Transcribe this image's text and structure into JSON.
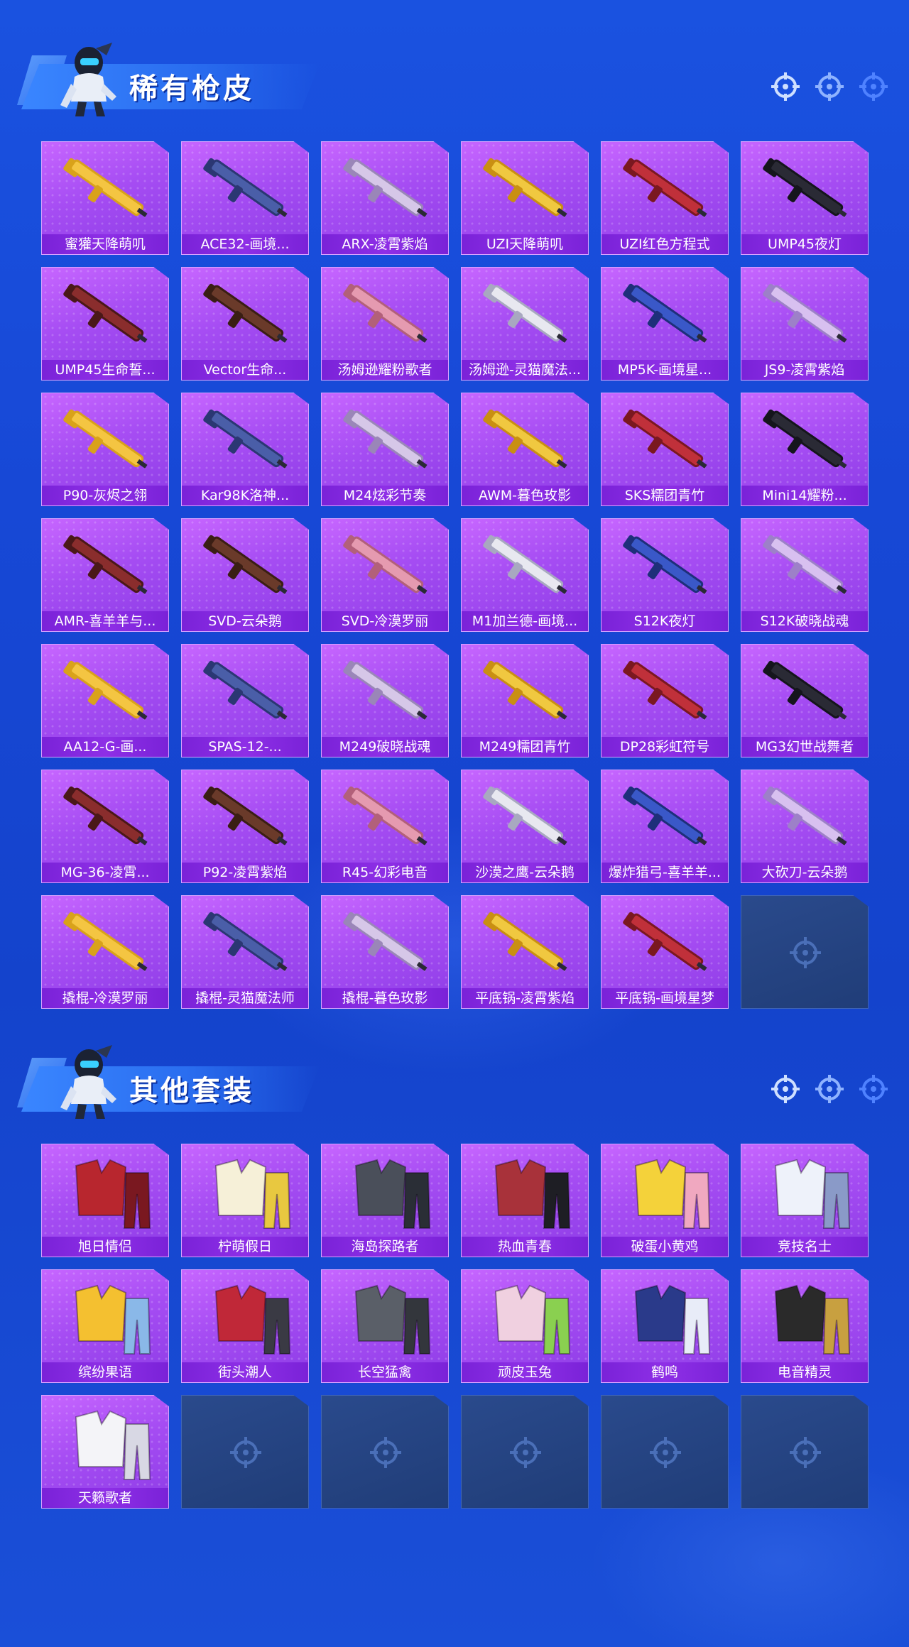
{
  "colors": {
    "background": "#1748d6",
    "card_purple": "#a64df3",
    "label_purple": "#8e2fe6",
    "empty_slot": "#203d78"
  },
  "sections": [
    {
      "title": "稀有枪皮",
      "items": [
        {
          "label": "蜜獾天降萌叽",
          "icon": "gun-skin-icon"
        },
        {
          "label": "ACE32-画境...",
          "icon": "gun-skin-icon"
        },
        {
          "label": "ARX-凌霄紫焰",
          "icon": "gun-skin-icon"
        },
        {
          "label": "UZI天降萌叽",
          "icon": "gun-skin-icon"
        },
        {
          "label": "UZI红色方程式",
          "icon": "gun-skin-icon"
        },
        {
          "label": "UMP45夜灯",
          "icon": "gun-skin-icon"
        },
        {
          "label": "UMP45生命誓...",
          "icon": "gun-skin-icon"
        },
        {
          "label": "Vector生命...",
          "icon": "gun-skin-icon"
        },
        {
          "label": "汤姆逊耀粉歌者",
          "icon": "gun-skin-icon"
        },
        {
          "label": "汤姆逊-灵猫魔法...",
          "icon": "gun-skin-icon"
        },
        {
          "label": "MP5K-画境星...",
          "icon": "gun-skin-icon"
        },
        {
          "label": "JS9-凌霄紫焰",
          "icon": "gun-skin-icon"
        },
        {
          "label": "P90-灰烬之翎",
          "icon": "gun-skin-icon"
        },
        {
          "label": "Kar98K洛神...",
          "icon": "gun-skin-icon"
        },
        {
          "label": "M24炫彩节奏",
          "icon": "gun-skin-icon"
        },
        {
          "label": "AWM-暮色玫影",
          "icon": "gun-skin-icon"
        },
        {
          "label": "SKS糯团青竹",
          "icon": "gun-skin-icon"
        },
        {
          "label": "Mini14耀粉...",
          "icon": "gun-skin-icon"
        },
        {
          "label": "AMR-喜羊羊与...",
          "icon": "gun-skin-icon"
        },
        {
          "label": "SVD-云朵鹅",
          "icon": "gun-skin-icon"
        },
        {
          "label": "SVD-冷漠罗丽",
          "icon": "gun-skin-icon"
        },
        {
          "label": "M1加兰德-画境...",
          "icon": "gun-skin-icon"
        },
        {
          "label": "S12K夜灯",
          "icon": "gun-skin-icon"
        },
        {
          "label": "S12K破晓战魂",
          "icon": "gun-skin-icon"
        },
        {
          "label": "AA12-G-画...",
          "icon": "gun-skin-icon"
        },
        {
          "label": "SPAS-12-...",
          "icon": "gun-skin-icon"
        },
        {
          "label": "M249破晓战魂",
          "icon": "gun-skin-icon"
        },
        {
          "label": "M249糯团青竹",
          "icon": "gun-skin-icon"
        },
        {
          "label": "DP28彩虹符号",
          "icon": "gun-skin-icon"
        },
        {
          "label": "MG3幻世战舞者",
          "icon": "gun-skin-icon"
        },
        {
          "label": "MG-36-凌霄...",
          "icon": "gun-skin-icon"
        },
        {
          "label": "P92-凌霄紫焰",
          "icon": "pistol-skin-icon"
        },
        {
          "label": "R45-幻彩电音",
          "icon": "revolver-skin-icon"
        },
        {
          "label": "沙漠之鹰-云朵鹅",
          "icon": "pistol-skin-icon"
        },
        {
          "label": "爆炸猎弓-喜羊羊...",
          "icon": "bow-skin-icon"
        },
        {
          "label": "大砍刀-云朵鹅",
          "icon": "machete-skin-icon"
        },
        {
          "label": "撬棍-冷漠罗丽",
          "icon": "crowbar-skin-icon"
        },
        {
          "label": "撬棍-灵猫魔法师",
          "icon": "crowbar-skin-icon"
        },
        {
          "label": "撬棍-暮色玫影",
          "icon": "crowbar-skin-icon"
        },
        {
          "label": "平底锅-凌霄紫焰",
          "icon": "pan-skin-icon"
        },
        {
          "label": "平底锅-画境星梦",
          "icon": "pan-skin-icon"
        }
      ],
      "empty_slots": 1
    },
    {
      "title": "其他套装",
      "items": [
        {
          "label": "旭日情侣",
          "icon": "outfit-icon"
        },
        {
          "label": "柠萌假日",
          "icon": "outfit-icon"
        },
        {
          "label": "海岛探路者",
          "icon": "outfit-icon"
        },
        {
          "label": "热血青春",
          "icon": "outfit-icon"
        },
        {
          "label": "破蛋小黄鸡",
          "icon": "outfit-icon"
        },
        {
          "label": "竞技名士",
          "icon": "outfit-icon"
        },
        {
          "label": "缤纷果语",
          "icon": "outfit-icon"
        },
        {
          "label": "街头潮人",
          "icon": "outfit-icon"
        },
        {
          "label": "长空猛禽",
          "icon": "outfit-icon"
        },
        {
          "label": "顽皮玉兔",
          "icon": "outfit-icon"
        },
        {
          "label": "鹤鸣",
          "icon": "outfit-icon"
        },
        {
          "label": "电音精灵",
          "icon": "outfit-icon"
        },
        {
          "label": "天籁歌者",
          "icon": "outfit-icon"
        }
      ],
      "empty_slots": 5
    }
  ]
}
